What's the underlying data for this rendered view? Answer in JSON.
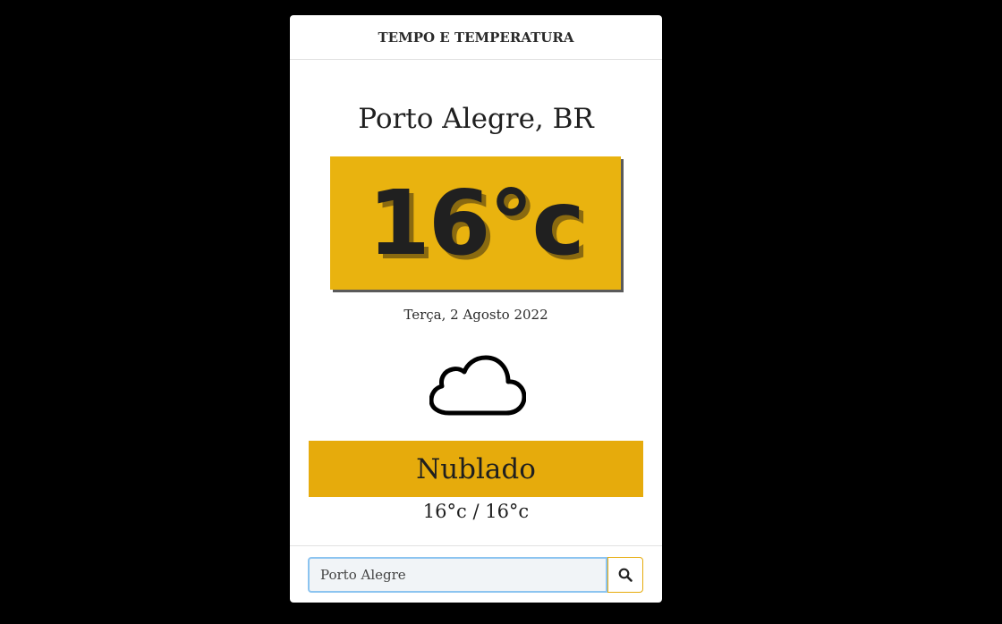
{
  "header": {
    "title": "TEMPO E TEMPERATURA"
  },
  "weather": {
    "city": "Porto Alegre, BR",
    "temperature": "16°c",
    "date": "Terça, 2 Agosto 2022",
    "icon": "cloud-icon",
    "condition": "Nublado",
    "min_max": "16°c / 16°c"
  },
  "search": {
    "value": "Porto Alegre",
    "button_icon": "search-icon"
  },
  "colors": {
    "background": "#000000",
    "temp_box": "#e9b30f",
    "condition_box": "#e6ab0c",
    "input_border": "#8cc4f0"
  }
}
